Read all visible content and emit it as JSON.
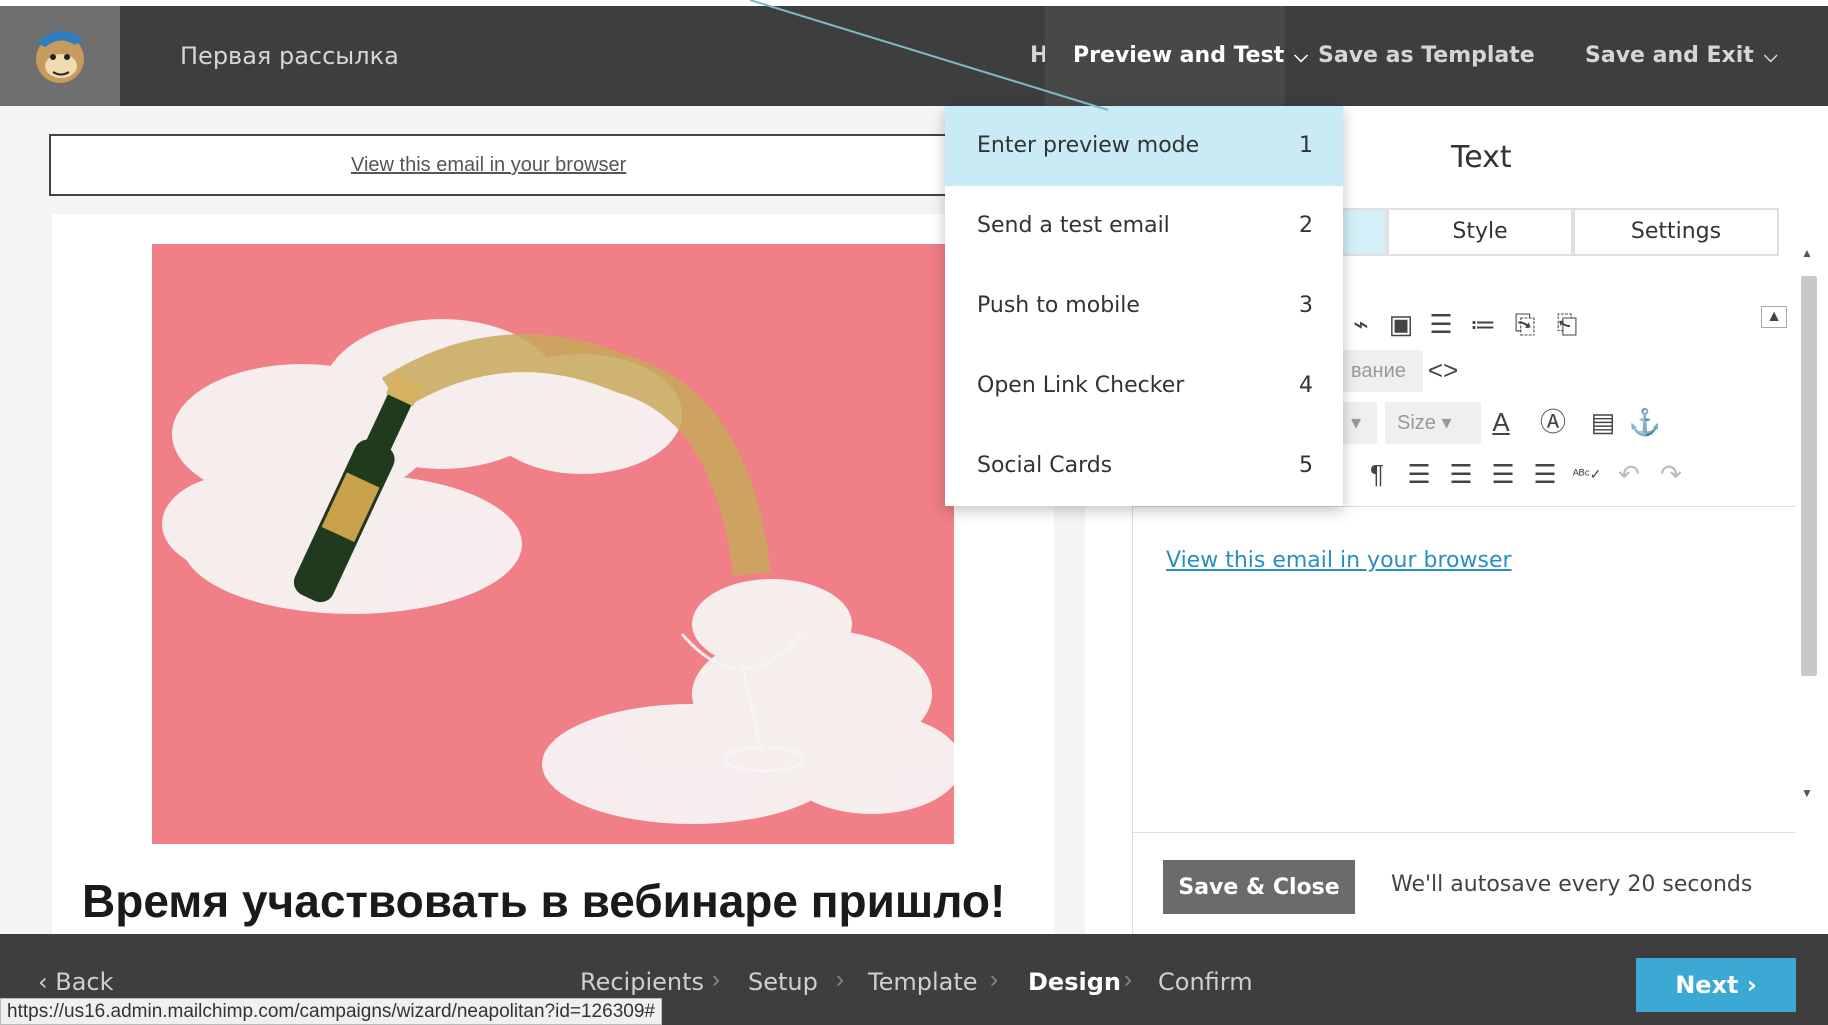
{
  "app": {
    "campaign_title": "Первая рассылка"
  },
  "header": {
    "help": "Help",
    "preview_and_test": "Preview and Test",
    "save_as_template": "Save as Template",
    "save_and_exit": "Save and Exit"
  },
  "preview_menu": {
    "items": [
      {
        "label": "Enter preview mode",
        "key": "1"
      },
      {
        "label": "Send a test email",
        "key": "2"
      },
      {
        "label": "Push to mobile",
        "key": "3"
      },
      {
        "label": "Open Link Checker",
        "key": "4"
      },
      {
        "label": "Social Cards",
        "key": "5"
      }
    ]
  },
  "email": {
    "view_in_browser": "View this email in your browser",
    "headline": "Время участвовать в вебинаре пришло!"
  },
  "panel": {
    "title": "Text",
    "tabs": {
      "content": "",
      "style": "Style",
      "settings": "Settings"
    },
    "format_select": "вание",
    "size_select": "Size",
    "editor_link": "View this email in your browser",
    "save_close": "Save & Close",
    "autosave": "We'll autosave every 20 seconds"
  },
  "footer": {
    "back": "Back",
    "steps": [
      "Recipients",
      "Setup",
      "Template",
      "Design",
      "Confirm"
    ],
    "next": "Next"
  },
  "statusbar": {
    "url": "https://us16.admin.mailchimp.com/campaigns/wizard/neapolitan?id=126309#"
  },
  "colors": {
    "topbar": "#3e3e3e",
    "accent_blue": "#3ba9d4",
    "menu_highlight": "#c9ebf6",
    "hero_pink": "#f07f87"
  }
}
